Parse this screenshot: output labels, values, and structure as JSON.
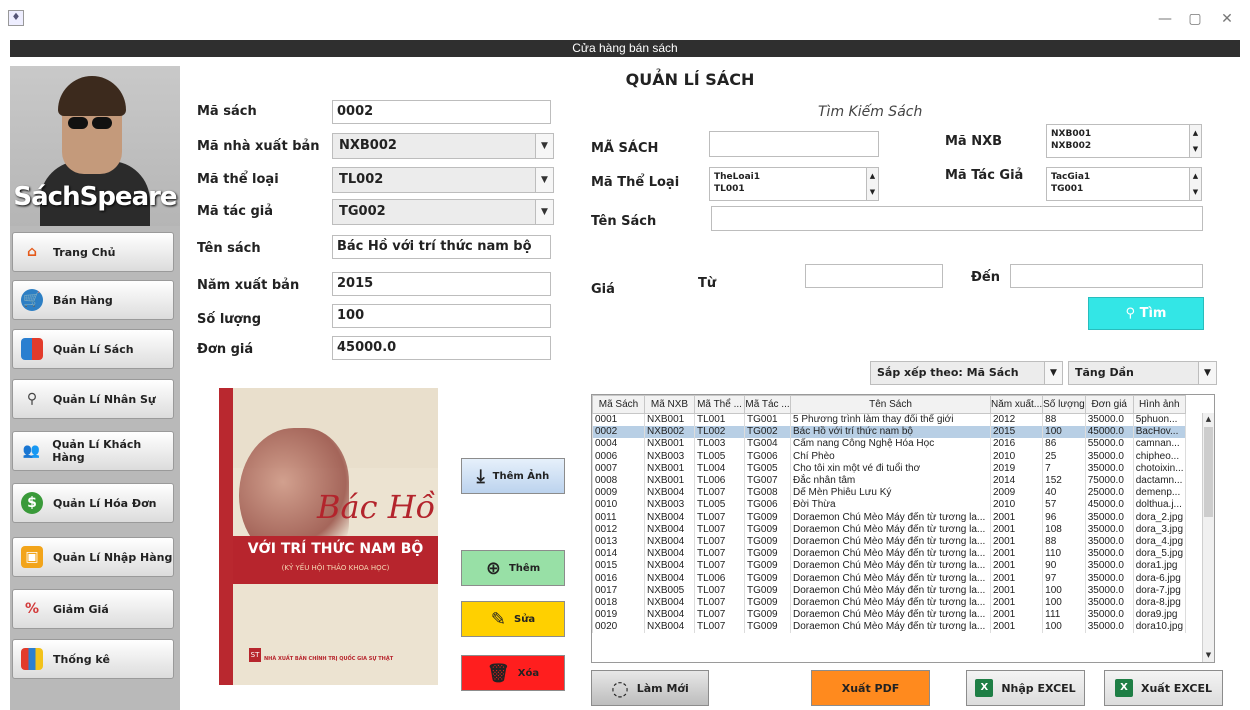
{
  "window": {
    "title_bar": "Cửa hàng bán sách",
    "controls": [
      "—",
      "▢",
      "✕"
    ]
  },
  "sidebar": {
    "logo_text": "SáchSpeare",
    "items": [
      {
        "label": "Trang Chủ",
        "icon": "home-icon"
      },
      {
        "label": "Bán Hàng",
        "icon": "cart-icon"
      },
      {
        "label": "Quản Lí Sách",
        "icon": "book-icon"
      },
      {
        "label": "Quản Lí Nhân Sự",
        "icon": "user-search-icon"
      },
      {
        "label": "Quản Lí Khách Hàng",
        "icon": "customers-icon"
      },
      {
        "label": "Quản Lí Hóa Đơn",
        "icon": "money-bag-icon"
      },
      {
        "label": "Quản Lí Nhập Hàng",
        "icon": "import-icon"
      },
      {
        "label": "Giảm Giá",
        "icon": "discount-icon"
      },
      {
        "label": "Thống kê",
        "icon": "chart-icon"
      }
    ]
  },
  "page": {
    "title": "QUẢN LÍ SÁCH"
  },
  "form": {
    "ma_sach": {
      "label": "Mã sách",
      "value": "0002"
    },
    "ma_nxb": {
      "label": "Mã nhà xuất bản",
      "value": "NXB002"
    },
    "ma_the_loai": {
      "label": "Mã thể loại",
      "value": "TL002"
    },
    "ma_tac_gia": {
      "label": "Mã tác giả",
      "value": "TG002"
    },
    "ten_sach": {
      "label": "Tên sách",
      "value": "Bác Hồ với trí thức nam bộ"
    },
    "nam_xb": {
      "label": "Năm xuất bản",
      "value": "2015"
    },
    "so_luong": {
      "label": "Số lượng",
      "value": "100"
    },
    "don_gia": {
      "label": "Đơn giá",
      "value": "45000.0"
    }
  },
  "cover": {
    "script_title": "Bác Hồ",
    "band_title": "VỚI TRÍ THỨC NAM BỘ",
    "band_subtitle": "(KỶ YẾU HỘI THẢO KHOA HỌC)",
    "publisher": "NHÀ XUẤT BẢN CHÍNH TRỊ QUỐC GIA SỰ THẬT",
    "logo": "ST"
  },
  "actions": {
    "them_anh": "Thêm Ảnh",
    "them": "Thêm",
    "sua": "Sửa",
    "xoa": "Xóa"
  },
  "search": {
    "title": "Tìm Kiếm Sách",
    "ma_sach_label": "MÃ SÁCH",
    "ma_sach_value": "",
    "ma_nxb_label": "Mã NXB",
    "ma_nxb_options": [
      "NXB001",
      "NXB002"
    ],
    "ma_the_loai_label": "Mã Thể Loại",
    "ma_the_loai_options": [
      "TheLoai1",
      "TL001"
    ],
    "ma_tac_gia_label": "Mã Tác Giả",
    "ma_tac_gia_options": [
      "TacGia1",
      "TG001"
    ],
    "ten_sach_label": "Tên Sách",
    "ten_sach_value": "",
    "gia_label": "Giá",
    "tu_label": "Từ",
    "den_label": "Đến",
    "tu_value": "",
    "den_value": "",
    "find_button": "Tìm"
  },
  "sort": {
    "by": "Sắp xếp theo: Mã Sách",
    "order": "Tăng Dần"
  },
  "table": {
    "columns": [
      "Mã Sách",
      "Mã NXB",
      "Mã Thể ...",
      "Mã Tác ...",
      "Tên Sách",
      "Năm xuất...",
      "Số lượng",
      "Đơn giá",
      "Hình ảnh"
    ],
    "rows": [
      [
        "0001",
        "NXB001",
        "TL001",
        "TG001",
        "5 Phương trình làm thay đổi thế giới",
        "2012",
        "88",
        "35000.0",
        "5phuon..."
      ],
      [
        "0002",
        "NXB002",
        "TL002",
        "TG002",
        "Bác Hồ với trí thức nam bộ",
        "2015",
        "100",
        "45000.0",
        "BacHov..."
      ],
      [
        "0004",
        "NXB001",
        "TL003",
        "TG004",
        "Cẩm nang Công Nghệ Hóa Học",
        "2016",
        "86",
        "55000.0",
        "camnan..."
      ],
      [
        "0006",
        "NXB003",
        "TL005",
        "TG006",
        "Chí Phèo",
        "2010",
        "25",
        "35000.0",
        "chipheo..."
      ],
      [
        "0007",
        "NXB001",
        "TL004",
        "TG005",
        "Cho tôi xin một vé đi tuổi thơ",
        "2019",
        "7",
        "35000.0",
        "chotoixin..."
      ],
      [
        "0008",
        "NXB001",
        "TL006",
        "TG007",
        "Đắc nhân tâm",
        "2014",
        "152",
        "75000.0",
        "dactamn..."
      ],
      [
        "0009",
        "NXB004",
        "TL007",
        "TG008",
        "Dế Mèn Phiêu Lưu Ký",
        "2009",
        "40",
        "25000.0",
        "demenp..."
      ],
      [
        "0010",
        "NXB003",
        "TL005",
        "TG006",
        "Đời Thừa",
        "2010",
        "57",
        "45000.0",
        "dolthua.j..."
      ],
      [
        "0011",
        "NXB004",
        "TL007",
        "TG009",
        "Doraemon Chú Mèo Máy đến từ tương la...",
        "2001",
        "96",
        "35000.0",
        "dora_2.jpg"
      ],
      [
        "0012",
        "NXB004",
        "TL007",
        "TG009",
        "Doraemon Chú Mèo Máy đến từ tương la...",
        "2001",
        "108",
        "35000.0",
        "dora_3.jpg"
      ],
      [
        "0013",
        "NXB004",
        "TL007",
        "TG009",
        "Doraemon Chú Mèo Máy đến từ tương la...",
        "2001",
        "88",
        "35000.0",
        "dora_4.jpg"
      ],
      [
        "0014",
        "NXB004",
        "TL007",
        "TG009",
        "Doraemon Chú Mèo Máy đến từ tương la...",
        "2001",
        "110",
        "35000.0",
        "dora_5.jpg"
      ],
      [
        "0015",
        "NXB004",
        "TL007",
        "TG009",
        "Doraemon Chú Mèo Máy đến từ tương la...",
        "2001",
        "90",
        "35000.0",
        "dora1.jpg"
      ],
      [
        "0016",
        "NXB004",
        "TL006",
        "TG009",
        "Doraemon Chú Mèo Máy đến từ tương la...",
        "2001",
        "97",
        "35000.0",
        "dora-6.jpg"
      ],
      [
        "0017",
        "NXB005",
        "TL007",
        "TG009",
        "Doraemon Chú Mèo Máy đến từ tương la...",
        "2001",
        "100",
        "35000.0",
        "dora-7.jpg"
      ],
      [
        "0018",
        "NXB004",
        "TL007",
        "TG009",
        "Doraemon Chú Mèo Máy đến từ tương la...",
        "2001",
        "100",
        "35000.0",
        "dora-8.jpg"
      ],
      [
        "0019",
        "NXB004",
        "TL007",
        "TG009",
        "Doraemon Chú Mèo Máy đến từ tương la...",
        "2001",
        "111",
        "35000.0",
        "dora9.jpg"
      ],
      [
        "0020",
        "NXB004",
        "TL007",
        "TG009",
        "Doraemon Chú Mèo Máy đến từ tương la...",
        "2001",
        "100",
        "35000.0",
        "dora10.jpg"
      ]
    ],
    "selected_row": 1
  },
  "bottom": {
    "lam_moi": "Làm Mới",
    "xuat_pdf": "Xuất PDF",
    "nhap_excel": "Nhập EXCEL",
    "xuat_excel": "Xuất EXCEL"
  },
  "colors": {
    "find": "#33e6e6",
    "them": "#98e0a6",
    "sua": "#ffd000",
    "xoa": "#ff1e1e",
    "pdf": "#ff8a1e",
    "selected_row": "#b8cfe5"
  }
}
